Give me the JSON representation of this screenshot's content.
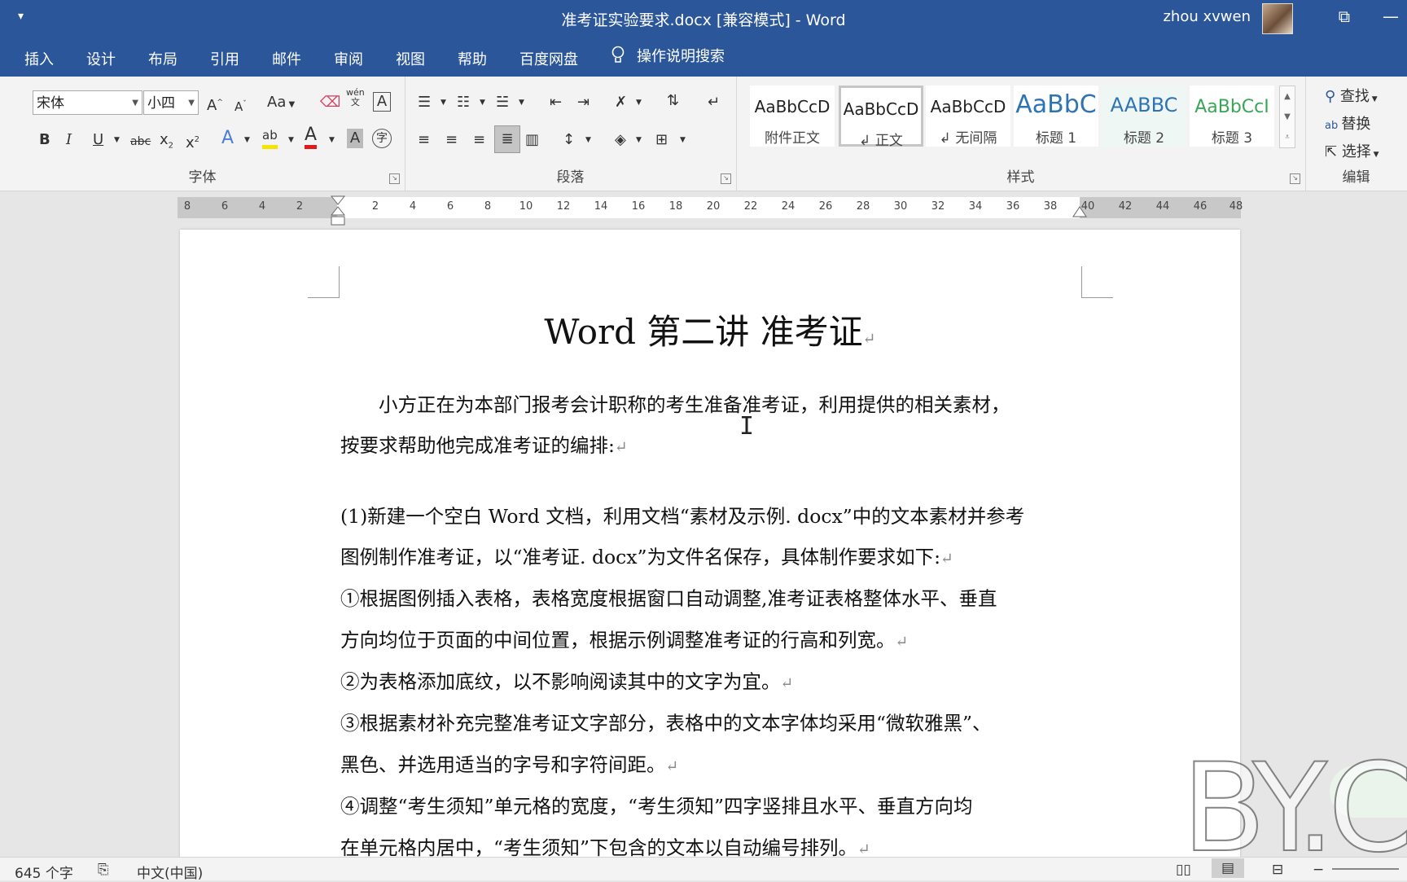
{
  "window": {
    "title": "准考证实验要求.docx [兼容模式]  -  Word",
    "user": "zhou xvwen",
    "qat_icon": "▾",
    "restore_icon": "⧉",
    "minimize_icon": "—"
  },
  "ribbon_tabs": [
    "插入",
    "设计",
    "布局",
    "引用",
    "邮件",
    "审阅",
    "视图",
    "帮助",
    "百度网盘"
  ],
  "tell_me": "操作说明搜索",
  "font_group": {
    "label": "字体",
    "font_name": "宋体",
    "font_size": "小四",
    "change_case": "Aa",
    "phonetic": "wén"
  },
  "paragraph_group": {
    "label": "段落"
  },
  "styles_group": {
    "label": "样式",
    "styles": [
      {
        "sample": "AaBbCcD",
        "name": "附件正文",
        "color": "#222222"
      },
      {
        "sample": "AaBbCcD",
        "name": "↲ 正文",
        "color": "#222222",
        "selected": true
      },
      {
        "sample": "AaBbCcD",
        "name": "↲ 无间隔",
        "color": "#222222"
      },
      {
        "sample": "AaBbC",
        "name": "标题 1",
        "color": "#2e74b5"
      },
      {
        "sample": "AABBC",
        "name": "标题 2",
        "color": "#2e74b5"
      },
      {
        "sample": "AaBbCcI",
        "name": "标题 3",
        "color": "#3aa655"
      }
    ]
  },
  "editing_group": {
    "label": "编辑",
    "find": "查找",
    "replace": "替换",
    "select": "选择"
  },
  "ruler": {
    "left_ticks": [
      "8",
      "6",
      "4",
      "2"
    ],
    "right_ticks": [
      "2",
      "4",
      "6",
      "8",
      "10",
      "12",
      "14",
      "16",
      "18",
      "20",
      "22",
      "24",
      "26",
      "28",
      "30",
      "32",
      "34",
      "36",
      "38",
      "40",
      "42",
      "44",
      "46",
      "48"
    ]
  },
  "document": {
    "heading": "Word 第二讲  准考证",
    "paragraph_mark": "↵",
    "lines": [
      "　　小方正在为本部门报考会计职称的考生准备准考证，利用提供的相关素材，",
      "按要求帮助他完成准考证的编排:",
      "(1)新建一个空白 Word 文档，利用文档“素材及示例. docx”中的文本素材并参考",
      "图例制作准考证，以“准考证. docx”为文件名保存，具体制作要求如下:",
      "①根据图例插入表格，表格宽度根据窗口自动调整,准考证表格整体水平、垂直",
      "方向均位于页面的中间位置，根据示例调整准考证的行高和列宽。",
      "②为表格添加底纹，以不影响阅读其中的文字为宜。",
      "③根据素材补充完整准考证文字部分，表格中的文本字体均采用“微软雅黑”、",
      "黑色、并选用适当的字号和字符间距。",
      "④调整“考生须知”单元格的宽度，“考生须知”四字竖排且水平、垂直方向均",
      "在单元格内居中，“考生须知”下包含的文本以自动编号排列。"
    ],
    "line_has_mark": [
      false,
      true,
      false,
      true,
      false,
      true,
      true,
      false,
      true,
      false,
      true
    ]
  },
  "status": {
    "word_count": "645 个字",
    "language": "中文(中国)"
  },
  "watermark": "BY.C"
}
